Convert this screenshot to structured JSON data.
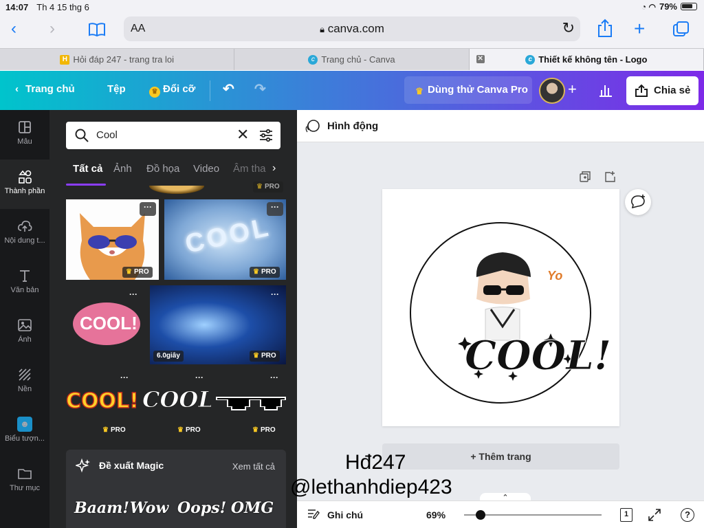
{
  "status": {
    "time": "14:07",
    "date": "Th 4 15 thg 6",
    "battery": "79%"
  },
  "browser": {
    "aa": "AA",
    "url": "canva.com",
    "tabs": [
      {
        "label": "Hỏi đáp 247 - trang tra loi"
      },
      {
        "label": "Trang chủ - Canva"
      },
      {
        "label": "Thiết kế không tên - Logo"
      }
    ]
  },
  "header": {
    "home": "Trang chủ",
    "file": "Tệp",
    "resize": "Đổi cỡ",
    "try_pro": "Dùng thử Canva Pro",
    "share": "Chia sẻ"
  },
  "rail": [
    {
      "label": "Mẫu"
    },
    {
      "label": "Thành phần"
    },
    {
      "label": "Nội dung t..."
    },
    {
      "label": "Văn bản"
    },
    {
      "label": "Ảnh"
    },
    {
      "label": "Nền"
    },
    {
      "label": "Biểu tượn..."
    },
    {
      "label": "Thư mục"
    }
  ],
  "panel": {
    "search_value": "Cool",
    "filters": [
      "Tất cả",
      "Ảnh",
      "Đồ họa",
      "Video",
      "Âm tha"
    ],
    "pro_label": "PRO",
    "video_duration": "6.0giây",
    "cool_sticker": "COOL!",
    "cool_yellow": "COOL!",
    "cool_white": "COOL!",
    "ice_text": "COOL",
    "magic_title": "Đề xuất Magic",
    "magic_link": "Xem tất cả",
    "magic_stickers": [
      "Baam!",
      "Wow",
      "Oops!",
      "OMG"
    ]
  },
  "editor": {
    "animate": "Hình động",
    "add_page": "+ Thêm trang",
    "notes": "Ghi chú",
    "zoom": "69%",
    "zoom_fraction": 0.12,
    "page_number": "1",
    "help": "?",
    "design_text": "COOL!",
    "design_yo": "Yo"
  },
  "watermark": {
    "line1": "Hđ247",
    "line2": "@lethanhdiep423"
  },
  "colors": {
    "accent": "#8b3dff",
    "header_start": "#00c4cc",
    "header_end": "#7d2ae8",
    "crown": "#f9c923",
    "ios_blue": "#1b7cf5"
  }
}
